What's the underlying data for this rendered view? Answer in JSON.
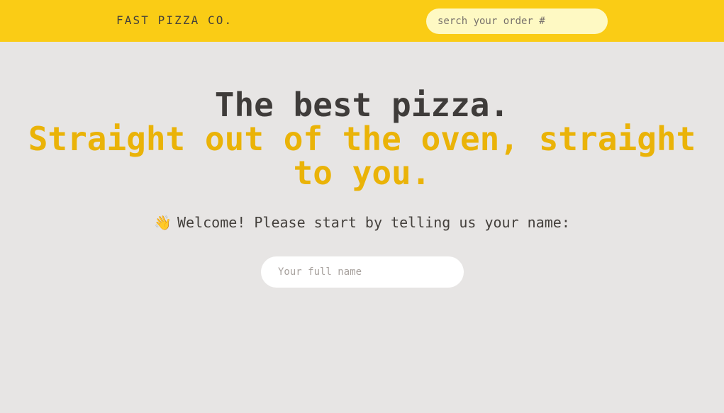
{
  "header": {
    "logo": "FAST PIZZA CO.",
    "search_placeholder": "serch your order #",
    "search_value": ""
  },
  "hero": {
    "line1": "The best pizza.",
    "line2": "Straight out of the oven, straight to you."
  },
  "welcome": {
    "icon": "waving-hand-icon",
    "emoji": "👋",
    "text": "Welcome! Please start by telling us your name:"
  },
  "name_input": {
    "placeholder": "Your full name",
    "value": ""
  },
  "colors": {
    "header_bg": "#facc15",
    "page_bg": "#e7e5e4",
    "accent": "#eab308",
    "text": "#44403c",
    "search_bg": "#fef9c3"
  }
}
